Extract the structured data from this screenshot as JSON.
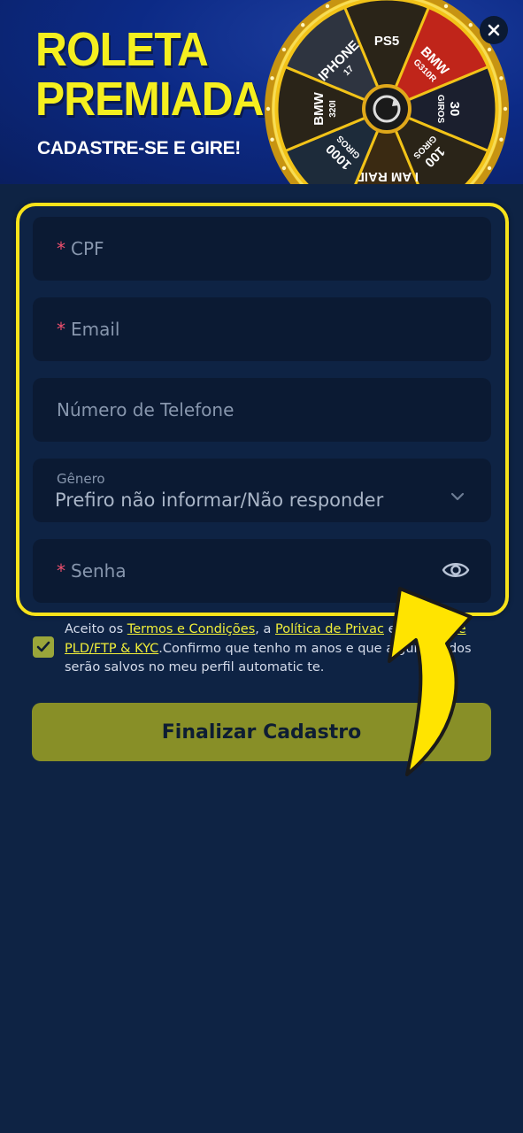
{
  "banner": {
    "title_line1": "ROLETA",
    "title_line2": "PREMIADA",
    "subtitle": "CADASTRE-SE E GIRE!",
    "wheel_segments": [
      {
        "l1": "PS5",
        "l2": ""
      },
      {
        "l1": "BMW",
        "l2": "G310R"
      },
      {
        "l1": "30",
        "l2": "GIROS"
      },
      {
        "l1": "100",
        "l2": "GIROS"
      },
      {
        "l1": "I AM RAID",
        "l2": ""
      },
      {
        "l1": "1000",
        "l2": "GIROS"
      },
      {
        "l1": "BMW",
        "l2": "320I"
      },
      {
        "l1": "IPHONE",
        "l2": "17"
      }
    ]
  },
  "form": {
    "cpf": {
      "required_mark": "*",
      "placeholder": "CPF"
    },
    "email": {
      "required_mark": "*",
      "placeholder": "Email"
    },
    "phone": {
      "placeholder": "Número de Telefone"
    },
    "gender": {
      "label": "Gênero",
      "value": "Prefiro não informar/Não responder"
    },
    "password": {
      "required_mark": "*",
      "placeholder": "Senha"
    }
  },
  "terms": {
    "prefix": "Aceito os ",
    "link1": "Termos e Condições",
    "mid1": ", a ",
    "link2": "Política de Privac",
    "mid2": "   e ",
    "link3": "Política de PLD/FTP & KYC",
    "suffix": ".Confirmo que tenho m      anos e que alguns dados serão salvos no meu perfil automatic       te."
  },
  "submit_label": "Finalizar Cadastro",
  "colors": {
    "background": "#0e2344",
    "field": "#0b1a33",
    "highlight": "#f7e21a",
    "accent": "#888f27",
    "link": "#f1ef39",
    "required": "#f0506e"
  },
  "icons": {
    "close": "close-icon",
    "chevron": "chevron-down-icon",
    "eye": "eye-icon",
    "check": "check-icon",
    "arrow": "curved-arrow-icon"
  }
}
